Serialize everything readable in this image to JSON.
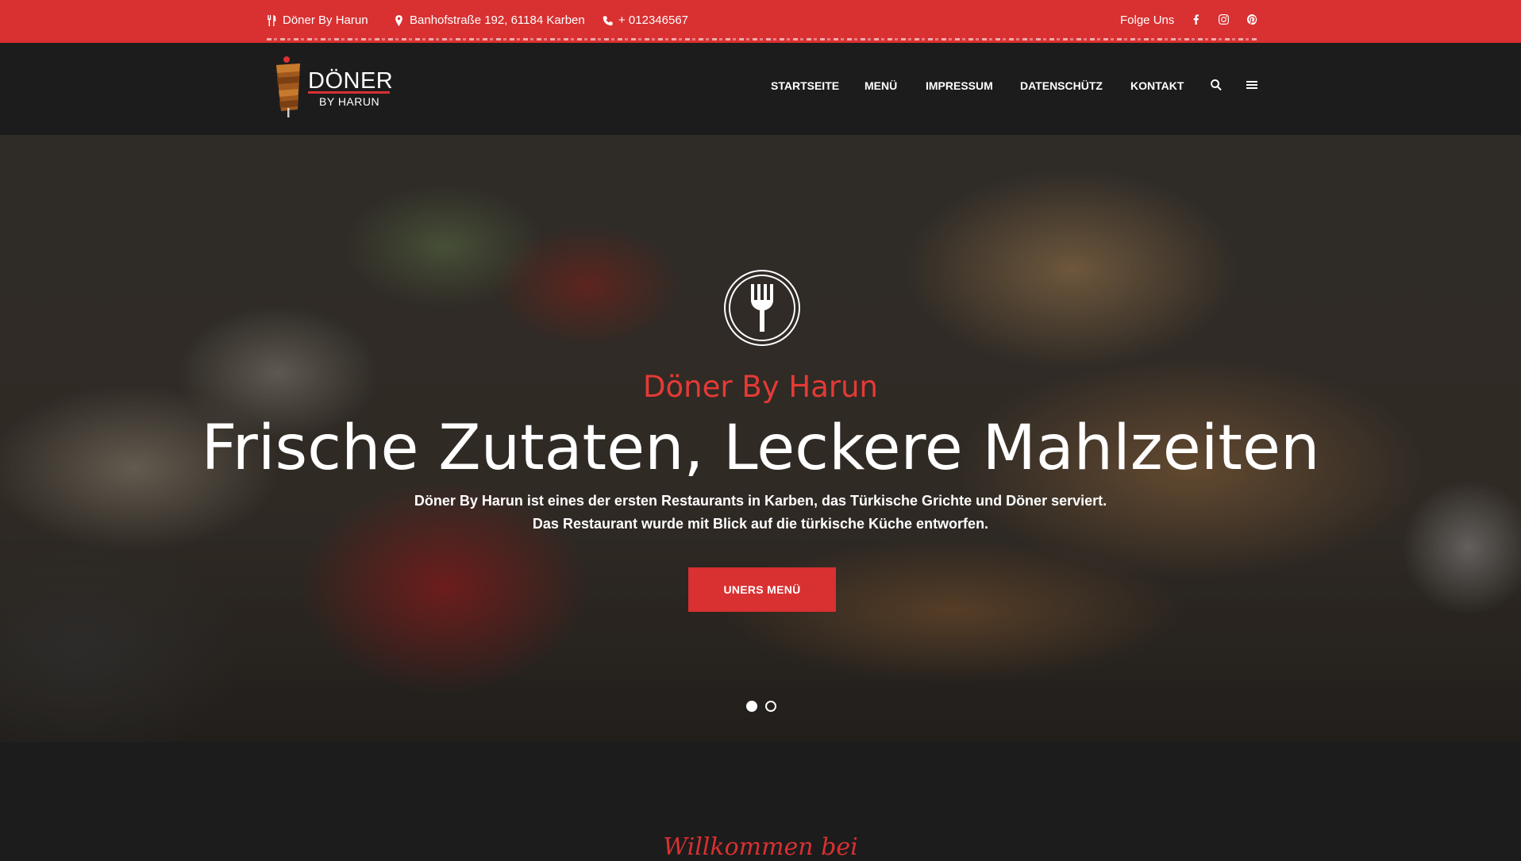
{
  "topbar": {
    "name": "Döner By Harun",
    "address": "Banhofstraße 192, 61184 Karben",
    "phone": "+ 012346567",
    "follow": "Folge Uns",
    "socials": [
      "facebook-icon",
      "instagram-icon",
      "pinterest-icon"
    ]
  },
  "logo": {
    "line1": "DÖNER",
    "line2": "BY HARUN"
  },
  "nav": {
    "items": [
      "STARTSEITE",
      "MENÜ",
      "IMPRESSUM",
      "DATENSCHÜTZ",
      "KONTAKT"
    ],
    "icons": [
      "search-icon",
      "menu-icon"
    ]
  },
  "hero": {
    "subtitle": "Döner By Harun",
    "title": "Frische Zutaten, Leckere Mahlzeiten",
    "text1": "Döner By Harun ist eines der ersten Restaurants in Karben, das Türkische Grichte und Döner serviert.",
    "text2": "Das Restaurant wurde mit Blick auf die türkische Küche entworfen.",
    "button": "UNERS MENÜ",
    "slides": 2,
    "active_slide": 1
  },
  "welcome": "Willkommen bei",
  "colors": {
    "accent": "#d93031",
    "dark": "#1c1c1c",
    "white": "#ffffff"
  }
}
